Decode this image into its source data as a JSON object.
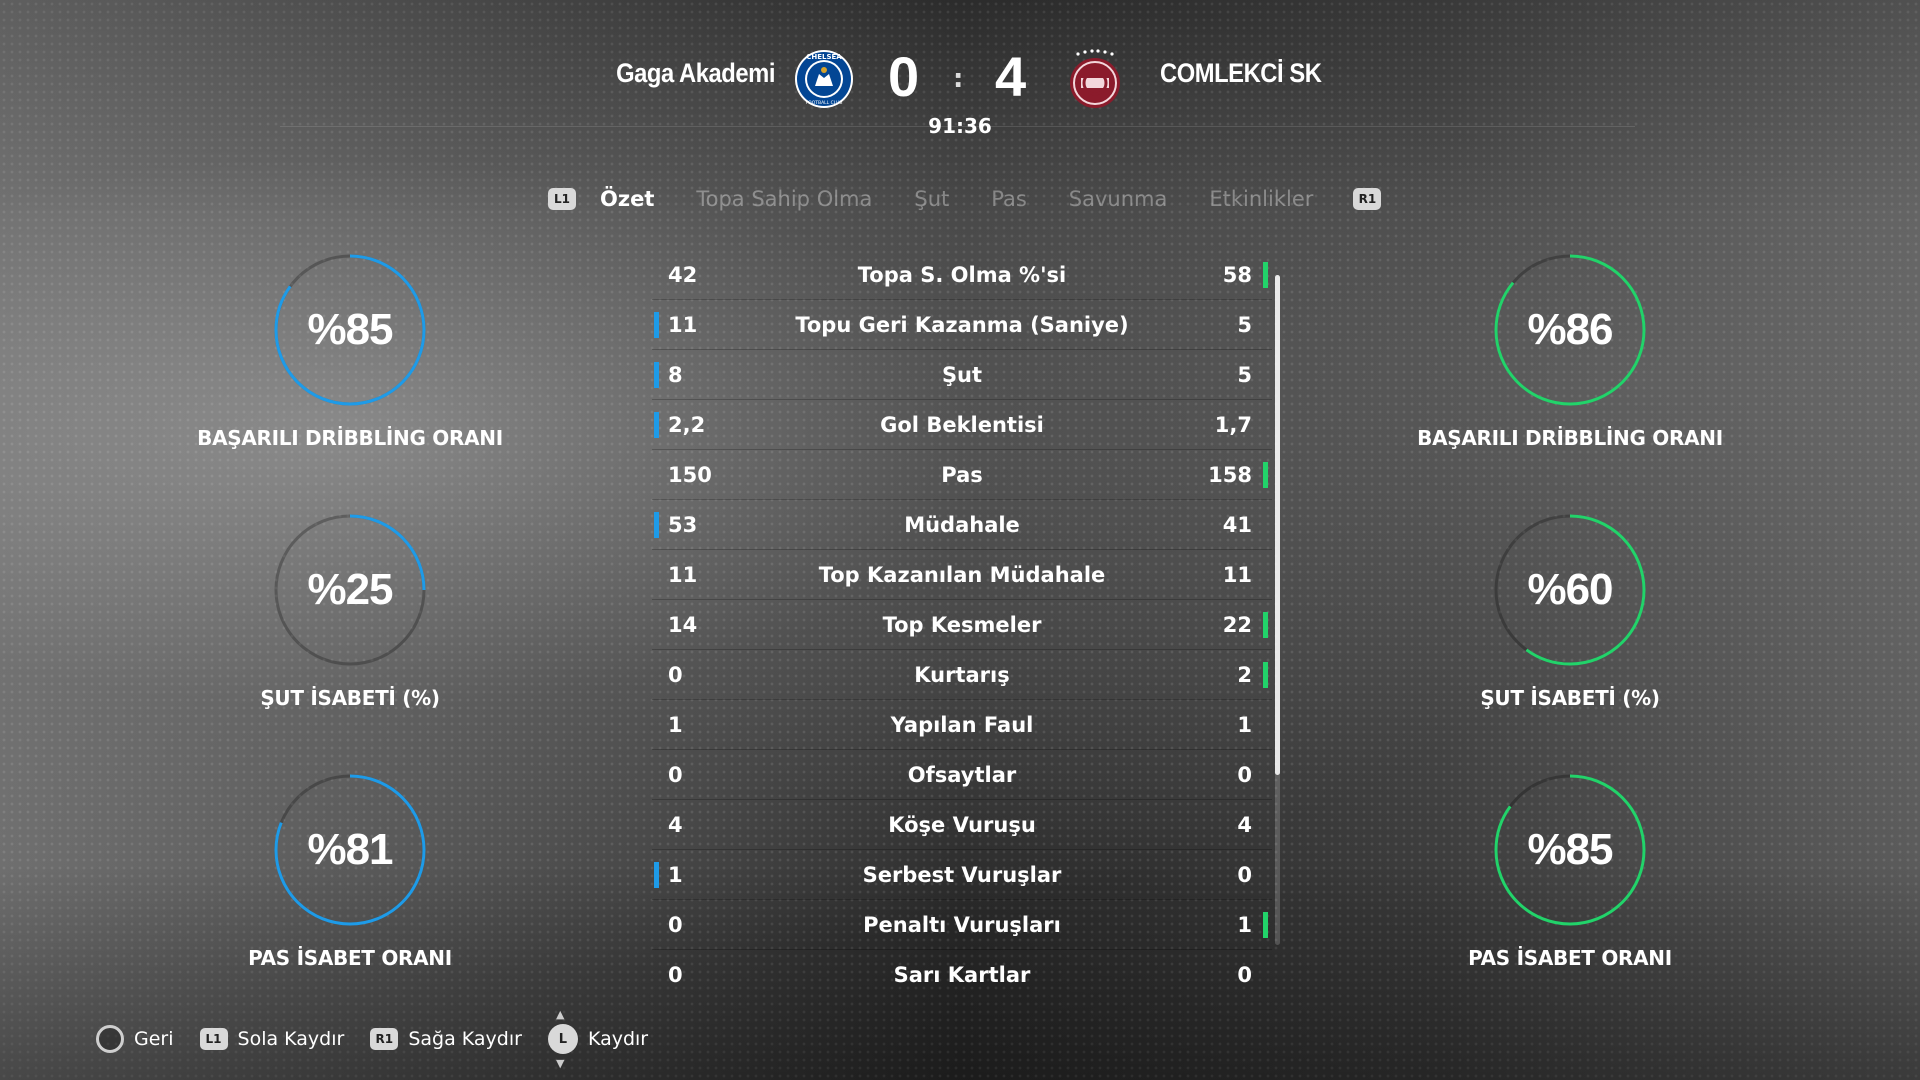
{
  "header": {
    "home_team": "Gaga Akademi",
    "away_team": "COMLEKCİ SK",
    "home_score": "0",
    "away_score": "4",
    "separator": ":",
    "match_time": "91:36",
    "home_crest_text": "CHELSEA",
    "home_crest_subtext": "FOOTBALL CLUB",
    "home_crest_color": "#034694",
    "away_crest_color": "#8b1b2b"
  },
  "tabs": {
    "prev_button": "L1",
    "next_button": "R1",
    "items": [
      "Özet",
      "Topa Sahip Olma",
      "Şut",
      "Pas",
      "Savunma",
      "Etkinlikler"
    ],
    "active_index": 0
  },
  "colors": {
    "home_accent": "#1e9be8",
    "away_accent": "#22d36a"
  },
  "home_rings": [
    {
      "label": "BAŞARILI DRİBBLİNG ORANI",
      "value": "%85",
      "percent": 85
    },
    {
      "label": "ŞUT İSABETİ (%)",
      "value": "%25",
      "percent": 25
    },
    {
      "label": "PAS İSABET ORANI",
      "value": "%81",
      "percent": 81
    }
  ],
  "away_rings": [
    {
      "label": "BAŞARILI DRİBBLİNG ORANI",
      "value": "%86",
      "percent": 86
    },
    {
      "label": "ŞUT İSABETİ (%)",
      "value": "%60",
      "percent": 60
    },
    {
      "label": "PAS İSABET ORANI",
      "value": "%85",
      "percent": 85
    }
  ],
  "stats": [
    {
      "label": "Topa S. Olma %'si",
      "home": "42",
      "away": "58",
      "lead": "away"
    },
    {
      "label": "Topu Geri Kazanma (Saniye)",
      "home": "11",
      "away": "5",
      "lead": "home"
    },
    {
      "label": "Şut",
      "home": "8",
      "away": "5",
      "lead": "home"
    },
    {
      "label": "Gol Beklentisi",
      "home": "2,2",
      "away": "1,7",
      "lead": "home"
    },
    {
      "label": "Pas",
      "home": "150",
      "away": "158",
      "lead": "away"
    },
    {
      "label": "Müdahale",
      "home": "53",
      "away": "41",
      "lead": "home"
    },
    {
      "label": "Top Kazanılan Müdahale",
      "home": "11",
      "away": "11",
      "lead": "none"
    },
    {
      "label": "Top Kesmeler",
      "home": "14",
      "away": "22",
      "lead": "away"
    },
    {
      "label": "Kurtarış",
      "home": "0",
      "away": "2",
      "lead": "away"
    },
    {
      "label": "Yapılan Faul",
      "home": "1",
      "away": "1",
      "lead": "none"
    },
    {
      "label": "Ofsaytlar",
      "home": "0",
      "away": "0",
      "lead": "none"
    },
    {
      "label": "Köşe Vuruşu",
      "home": "4",
      "away": "4",
      "lead": "none"
    },
    {
      "label": "Serbest Vuruşlar",
      "home": "1",
      "away": "0",
      "lead": "home"
    },
    {
      "label": "Penaltı Vuruşları",
      "home": "0",
      "away": "1",
      "lead": "away"
    },
    {
      "label": "Sarı Kartlar",
      "home": "0",
      "away": "0",
      "lead": "none"
    }
  ],
  "footer": {
    "back": "Geri",
    "scroll_left_btn": "L1",
    "scroll_left": "Sola Kaydır",
    "scroll_right_btn": "R1",
    "scroll_right": "Sağa Kaydır",
    "scroll_btn": "L",
    "scroll": "Kaydır"
  }
}
